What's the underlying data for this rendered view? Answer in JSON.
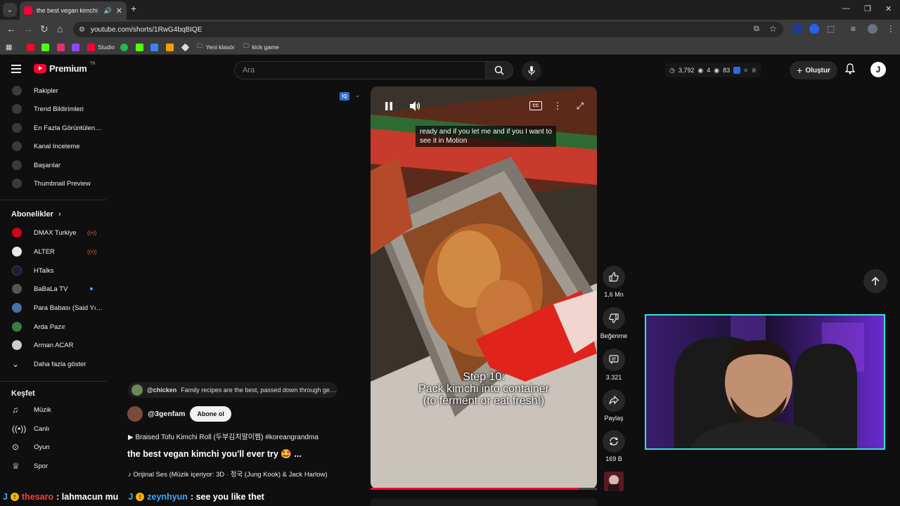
{
  "browser": {
    "tab_title": "the best vegan kimchi you'll ever try",
    "url": "youtube.com/shorts/1RwG4bqBIQE",
    "bookmarks": [
      {
        "label": "",
        "color": "#ff0033"
      },
      {
        "label": "",
        "color": "#53fc18"
      },
      {
        "label": "",
        "color": "#e1306c"
      },
      {
        "label": "",
        "color": "#9146ff"
      },
      {
        "label": "Studio",
        "color": "#ff0033"
      },
      {
        "label": "",
        "color": "#1db954"
      },
      {
        "label": "",
        "color": "#53fc18"
      },
      {
        "label": "",
        "color": "#3b82f6"
      },
      {
        "label": "",
        "color": "#f59e0b"
      },
      {
        "label": "",
        "color": "#dddddd"
      },
      {
        "label": "Yeni klasör",
        "color": "folder"
      },
      {
        "label": "kick game",
        "color": "folder"
      }
    ]
  },
  "masthead": {
    "logo_text": "Premium",
    "logo_region": "TR",
    "search_placeholder": "Ara",
    "stats": {
      "views": "3,792",
      "watching": "4",
      "other": "83"
    },
    "create_label": "Oluştur",
    "avatar_letter": "J"
  },
  "sidebar": {
    "top_items": [
      {
        "label": "Rakipler"
      },
      {
        "label": "Trend Bildirimleri"
      },
      {
        "label": "En Fazla Görüntülenenler"
      },
      {
        "label": "Kanal Inceleme"
      },
      {
        "label": "Başarılar"
      },
      {
        "label": "Thumbnail Preview"
      }
    ],
    "subscriptions_title": "Abonelikler",
    "subscriptions": [
      {
        "label": "DMAX Turkiye",
        "color": "#d0021b",
        "live": true
      },
      {
        "label": "ALTER",
        "color": "#e8e8e8",
        "live": true
      },
      {
        "label": "HTalks",
        "color": "#1b1b3a",
        "live": false
      },
      {
        "label": "BaBaLa TV",
        "color": "#555555",
        "dot": true
      },
      {
        "label": "Para Babası (Said Yılmaz)",
        "color": "#4a6fa5",
        "live": false
      },
      {
        "label": "Arda Pazır",
        "color": "#3c7a4a",
        "live": false
      },
      {
        "label": "Arman ACAR",
        "color": "#cccccc",
        "live": false
      }
    ],
    "show_more": "Daha fazla göster",
    "explore_title": "Keşfet",
    "explore": [
      {
        "label": "Müzik"
      },
      {
        "label": "Canlı"
      },
      {
        "label": "Oyun"
      },
      {
        "label": "Spor"
      }
    ]
  },
  "short": {
    "caption": "ready and if you let me and if you I want to see it in Motion",
    "overlay_text": "Step 10:\nPack kimchi into container\n(to ferment or eat fresh!)",
    "progress": 0.92,
    "actions": {
      "likes": "1,6 Mn",
      "dislike_label": "Beğenme",
      "comments": "3.321",
      "share_label": "Paylaş",
      "remix": "169 B"
    },
    "pinned_comment": {
      "user": "@chicken",
      "text": "Family recipes are the best, passed down through generations"
    },
    "channel": "@3genfam",
    "subscribe_label": "Abone ol",
    "playlist": "Braised Tofu Kimchi Roll (두부김치말이찜) #koreangrandma",
    "title": "the best vegan kimchi you'll ever try 🤩 ...",
    "audio": "Orijinal Ses (Müzik içeriyor: 3D · 정국 (Jung Kook) & Jack Harlow)"
  },
  "chat": [
    {
      "badge": "J",
      "user": "thesaro",
      "text": ": lahmacun mu"
    },
    {
      "badge": "J",
      "user": "zeynhyun",
      "text": ": see you like thet"
    }
  ]
}
